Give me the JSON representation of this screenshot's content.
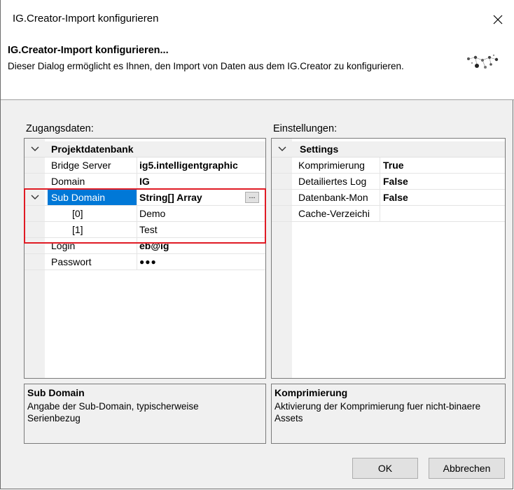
{
  "window": {
    "title": "IG.Creator-Import konfigurieren"
  },
  "header": {
    "title": "IG.Creator-Import konfigurieren...",
    "description": "Dieser Dialog ermöglicht es Ihnen, den Import von Daten aus dem IG.Creator zu konfigurieren."
  },
  "left": {
    "section_label": "Zugangsdaten:",
    "category": "Projektdatenbank",
    "rows": [
      {
        "name": "Bridge Server",
        "value": "ig5.intelligentgraphic"
      },
      {
        "name": "Domain",
        "value": "IG"
      },
      {
        "name": "Sub Domain",
        "value": "String[] Array"
      },
      {
        "name": "[0]",
        "value": "Demo"
      },
      {
        "name": "[1]",
        "value": "Test"
      },
      {
        "name": "Login",
        "value": "eb@ig"
      },
      {
        "name": "Passwort",
        "value": "●●●"
      }
    ],
    "ellipsis_label": "...",
    "desc_title": "Sub Domain",
    "desc_text": "Angabe der Sub-Domain, typischerweise Serienbezug"
  },
  "right": {
    "section_label": "Einstellungen:",
    "category": "Settings",
    "rows": [
      {
        "name": "Komprimierung",
        "value": "True"
      },
      {
        "name": "Detailiertes Log",
        "value": "False"
      },
      {
        "name": "Datenbank-Mon",
        "value": "False"
      },
      {
        "name": "Cache-Verzeichi",
        "value": ""
      }
    ],
    "desc_title": "Komprimierung",
    "desc_text": "Aktivierung der Komprimierung fuer nicht-binaere Assets"
  },
  "buttons": {
    "ok": "OK",
    "cancel": "Abbrechen"
  },
  "colors": {
    "selection": "#0078d7",
    "highlight_border": "#e01b24"
  }
}
